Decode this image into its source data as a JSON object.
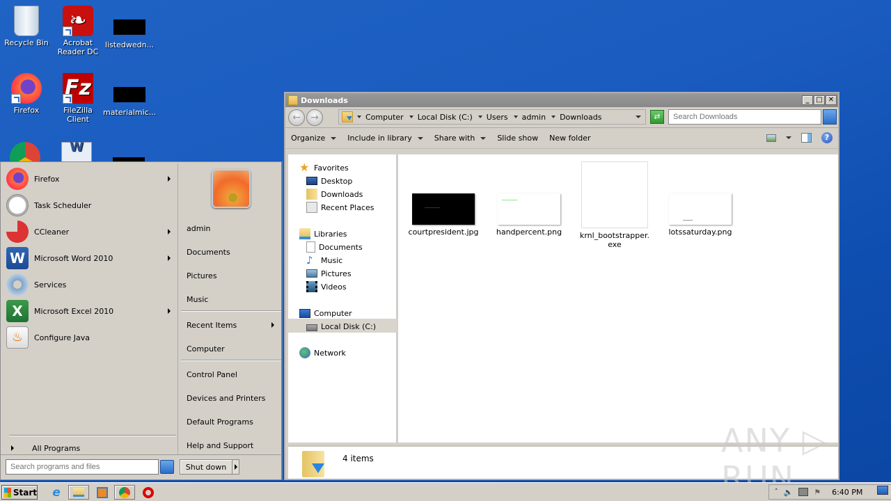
{
  "desktop": {
    "icons": [
      {
        "label": "Recycle Bin",
        "icon": "recycle-bin-icon"
      },
      {
        "label": "Acrobat Reader DC",
        "icon": "acrobat-icon"
      },
      {
        "label": "listedwedn...",
        "icon": "black-thumbnail-icon"
      },
      {
        "label": "Firefox",
        "icon": "firefox-icon"
      },
      {
        "label": "FileZilla Client",
        "icon": "filezilla-icon"
      },
      {
        "label": "materialmic...",
        "icon": "black-thumbnail-icon"
      }
    ]
  },
  "start_menu": {
    "programs": [
      {
        "label": "Firefox",
        "has_submenu": true
      },
      {
        "label": "Task Scheduler",
        "has_submenu": false
      },
      {
        "label": "CCleaner",
        "has_submenu": true
      },
      {
        "label": "Microsoft Word 2010",
        "has_submenu": true
      },
      {
        "label": "Services",
        "has_submenu": false
      },
      {
        "label": "Microsoft Excel 2010",
        "has_submenu": true
      },
      {
        "label": "Configure Java",
        "has_submenu": false
      }
    ],
    "all_programs": "All Programs",
    "right_items": [
      {
        "label": "admin"
      },
      {
        "label": "Documents"
      },
      {
        "label": "Pictures"
      },
      {
        "label": "Music"
      },
      {
        "label": "Recent Items",
        "has_submenu": true
      },
      {
        "label": "Computer"
      },
      {
        "label": "Control Panel"
      },
      {
        "label": "Devices and Printers"
      },
      {
        "label": "Default Programs"
      },
      {
        "label": "Help and Support"
      }
    ],
    "search_placeholder": "Search programs and files",
    "shutdown_label": "Shut down"
  },
  "explorer": {
    "title": "Downloads",
    "breadcrumb": [
      "Computer",
      "Local Disk (C:)",
      "Users",
      "admin",
      "Downloads"
    ],
    "search_placeholder": "Search Downloads",
    "toolbar": {
      "organize": "Organize",
      "include": "Include in library",
      "share": "Share with",
      "slideshow": "Slide show",
      "new_folder": "New folder"
    },
    "nav": {
      "favorites": "Favorites",
      "desktop": "Desktop",
      "downloads": "Downloads",
      "recent": "Recent Places",
      "libraries": "Libraries",
      "documents": "Documents",
      "music": "Music",
      "pictures": "Pictures",
      "videos": "Videos",
      "computer": "Computer",
      "local_disk": "Local Disk (C:)",
      "network": "Network"
    },
    "files": [
      {
        "name": "courtpresident.jpg"
      },
      {
        "name": "handpercent.png"
      },
      {
        "name": "krnl_bootstrapper.exe",
        "line1": "krnl_bootstrapper.",
        "line2": "exe"
      },
      {
        "name": "lotssaturday.png"
      }
    ],
    "status": "4 items"
  },
  "watermark": "ANY ▷ RUN",
  "taskbar": {
    "start": "Start",
    "clock": "6:40 PM"
  }
}
